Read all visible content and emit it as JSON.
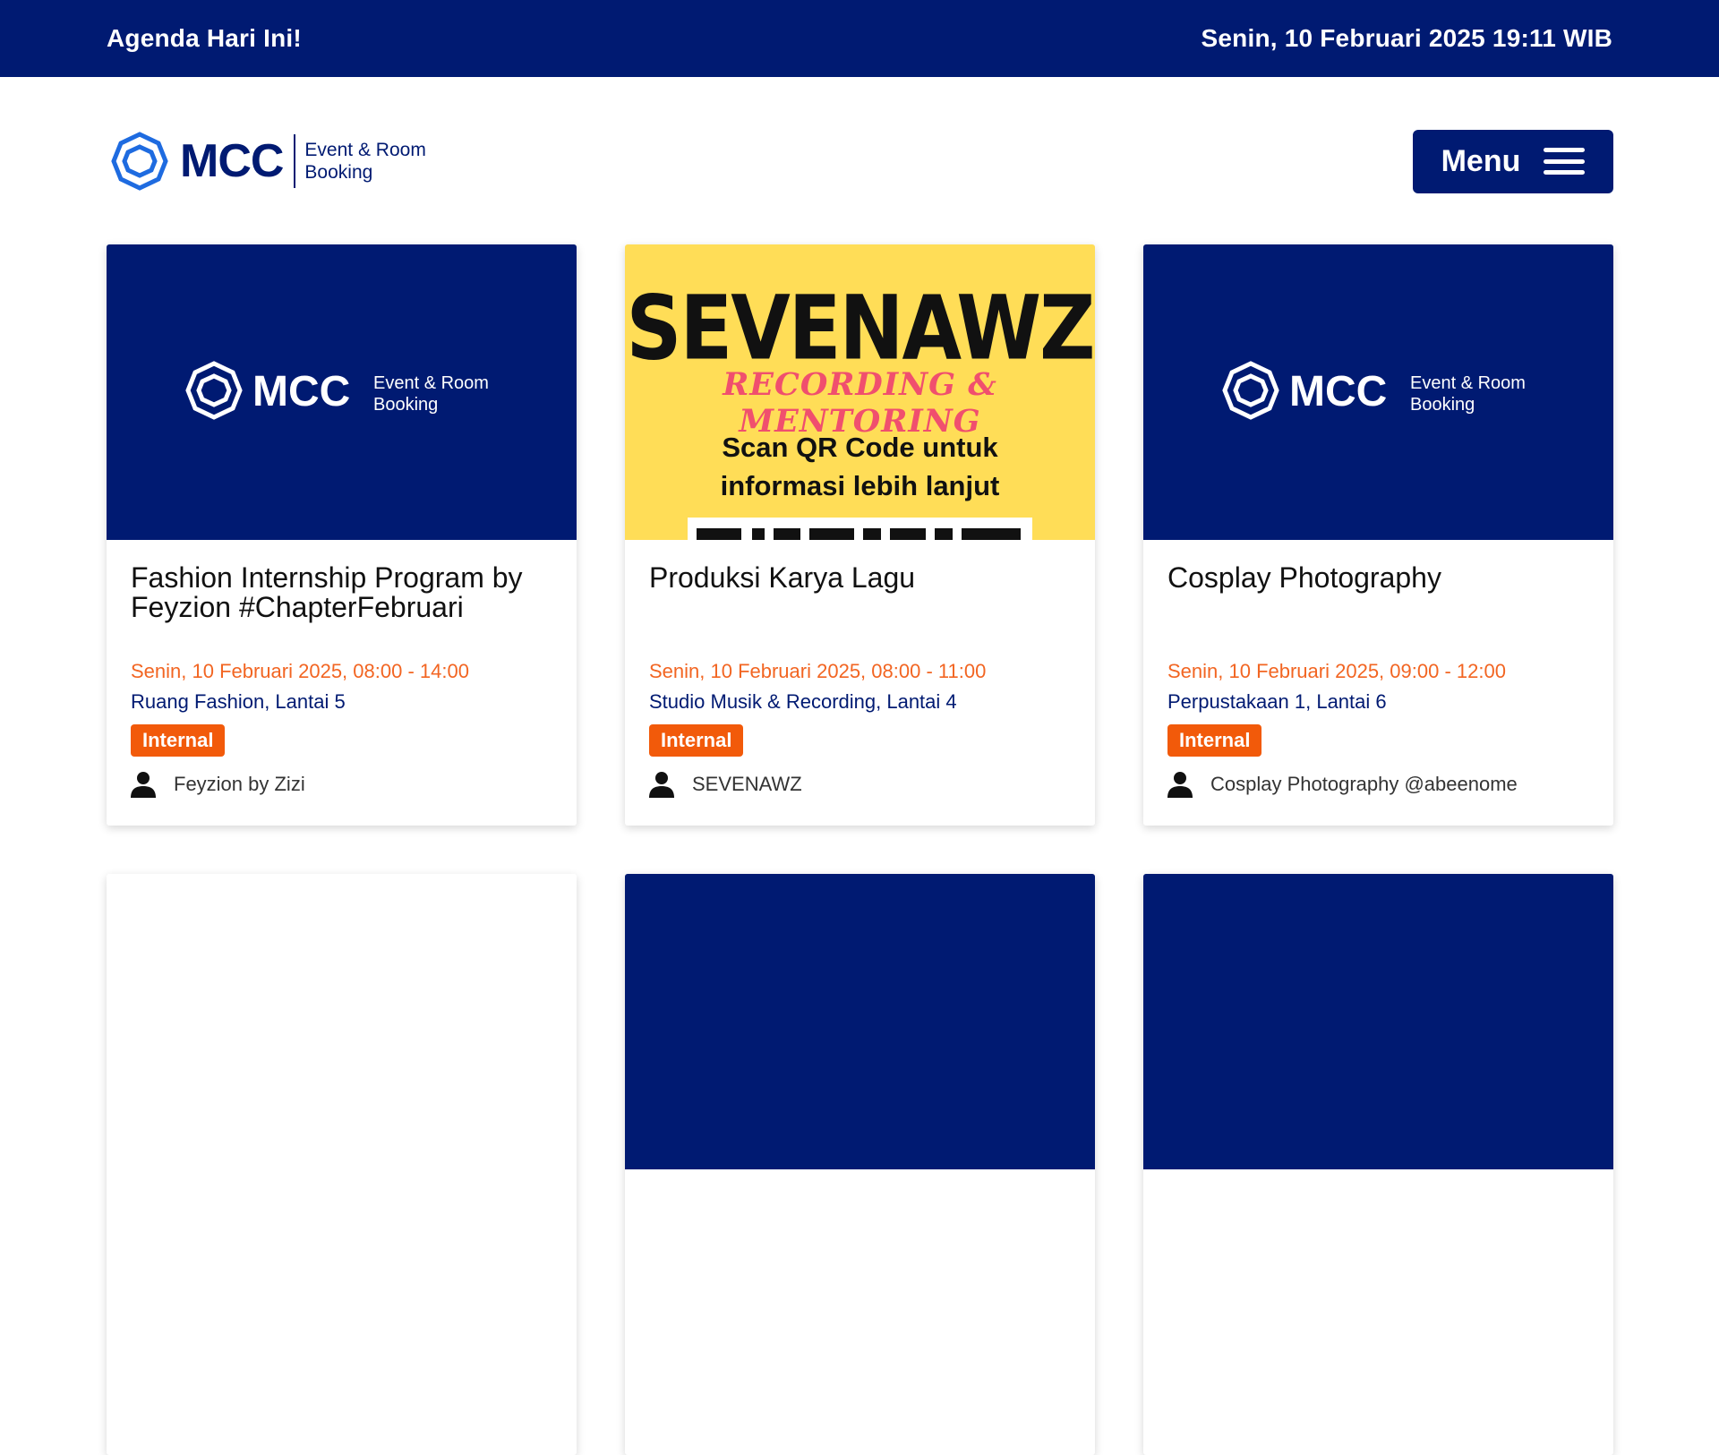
{
  "topbar": {
    "left": "Agenda Hari Ini!",
    "right": "Senin, 10 Februari 2025 19:11 WIB"
  },
  "brand": {
    "name": "MCC",
    "subtitle_line1": "Event & Room",
    "subtitle_line2": "Booking"
  },
  "menu": {
    "label": "Menu"
  },
  "colors": {
    "navy": "#001a72",
    "orange": "#f26522",
    "badge": "#f25a0a",
    "poster_yellow": "#ffdd57"
  },
  "events": [
    {
      "title": "Fashion Internship Program by Feyzion #ChapterFebruari",
      "when": "Senin, 10 Februari 2025, 08:00 - 14:00",
      "where": "Ruang Fashion, Lantai 5",
      "badge": "Internal",
      "organizer": "Feyzion by Zizi"
    },
    {
      "title": "Produksi Karya Lagu",
      "when": "Senin, 10 Februari 2025, 08:00 - 11:00",
      "where": "Studio Musik & Recording, Lantai 4",
      "badge": "Internal",
      "organizer": "SEVENAWZ",
      "poster": {
        "headline": "SEVENAWZ",
        "subline": "RECORDING & MENTORING",
        "scan_line1": "Scan QR Code untuk",
        "scan_line2": "informasi lebih lanjut"
      }
    },
    {
      "title": "Cosplay Photography",
      "when": "Senin, 10 Februari 2025, 09:00 - 12:00",
      "where": "Perpustakaan 1, Lantai 6",
      "badge": "Internal",
      "organizer": "Cosplay Photography @abeenome"
    }
  ]
}
